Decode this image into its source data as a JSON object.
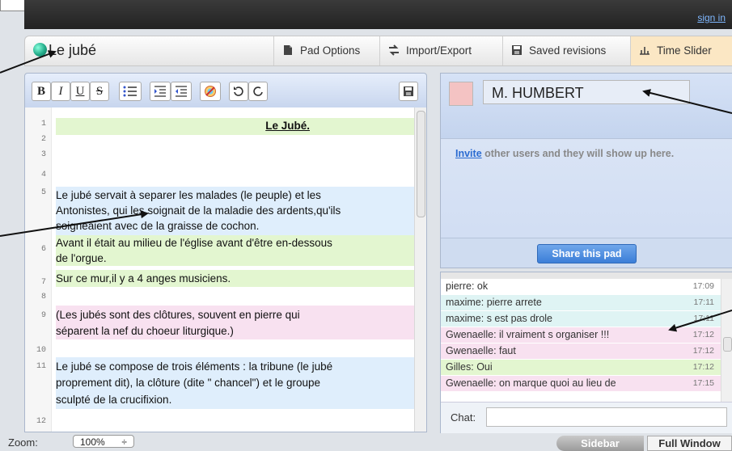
{
  "header": {
    "sign_in": "sign in"
  },
  "pad": {
    "title": "Le jubé"
  },
  "menu": {
    "pad_options": "Pad Options",
    "import_export": "Import/Export",
    "saved_revisions": "Saved revisions",
    "time_slider": "Time Slider"
  },
  "toolbar": {
    "bold": "B",
    "italic": "I",
    "underline": "U",
    "strike": "S"
  },
  "editor": {
    "line_numbers": [
      "1",
      "2",
      "3",
      "4",
      "5",
      "6",
      "7",
      "8",
      "9",
      "10",
      "11",
      "12"
    ],
    "lines": [
      "Le Jubé.",
      "Le jubé servait à separer les malades (le peuple) et les",
      "Antonistes, qui les soignait de la maladie des ardents,qu'ils",
      "soigneaient avec de la graisse de cochon.",
      "Avant il était au milieu de l'église avant d'être en-dessous",
      "de l'orgue.",
      "Sur ce mur,il y a 4 anges musiciens.",
      "(Les jubés sont des clôtures, souvent en pierre qui",
      "séparent la nef du choeur liturgique.)",
      "Le jubé se compose de trois éléments : la tribune (le jubé",
      "proprement dit), la clôture (dite \" chancel\")  et le groupe",
      "sculpté de la crucifixion."
    ]
  },
  "users": {
    "current_name": "M. HUMBERT",
    "invite_link": "Invite",
    "invite_text": " other users and they will show up here.",
    "share_button": "Share this pad"
  },
  "chat": {
    "label": "Chat:",
    "messages": [
      {
        "text": "pierre: ok",
        "time": "17:09"
      },
      {
        "text": "maxime: pierre arrete",
        "time": "17:11"
      },
      {
        "text": "maxime: s est pas drole",
        "time": "17:11"
      },
      {
        "text": "Gwenaelle: il vraiment s organiser !!!",
        "time": "17:12"
      },
      {
        "text": "Gwenaelle: faut",
        "time": "17:12"
      },
      {
        "text": "Gilles: Oui",
        "time": "17:12"
      },
      {
        "text": "Gwenaelle: on marque quoi au lieu de",
        "time": "17:15"
      }
    ]
  },
  "footer": {
    "zoom_label": "Zoom:",
    "zoom_value": "100%",
    "zoom_arrows": "÷",
    "sidebar": "Sidebar",
    "full_window": "Full Window"
  },
  "colors": {
    "author_green": "#e3f6d0",
    "author_blue": "#dfeefc",
    "author_pink": "#f8e1f0",
    "user_swatch": "#f4c3c3",
    "accent_blue": "#3b7ed8"
  }
}
